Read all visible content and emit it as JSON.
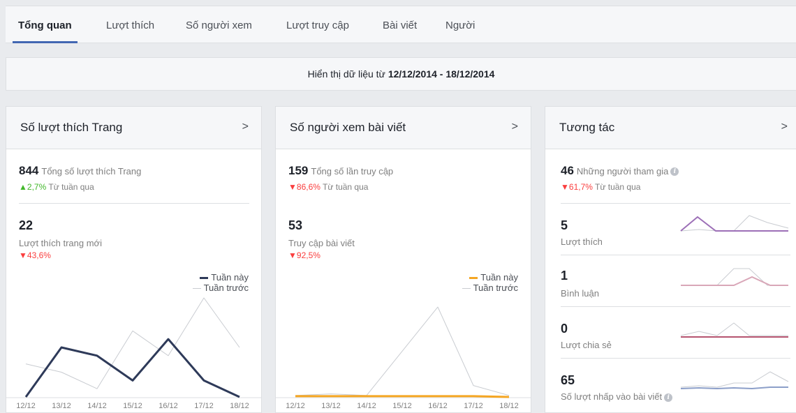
{
  "tabs": [
    {
      "label": "Tổng quan",
      "active": true
    },
    {
      "label": "Lượt thích"
    },
    {
      "label": "Số người xem"
    },
    {
      "label": "Lượt truy cập"
    },
    {
      "label": "Bài viết"
    },
    {
      "label": "Người"
    }
  ],
  "date_range": {
    "prefix": "Hiển thị dữ liệu từ",
    "range": "12/12/2014 - 18/12/2014"
  },
  "likes_card": {
    "title": "Số lượt thích Trang",
    "arrow": ">",
    "total_num": "844",
    "total_label": "Tổng số lượt thích Trang",
    "total_trend": "2,7%",
    "trend_suffix": "Từ tuần qua",
    "sub_num": "22",
    "sub_label": "Lượt thích trang mới",
    "sub_trend": "43,6%",
    "legend_this": "Tuần này",
    "legend_last": "Tuần trước"
  },
  "reach_card": {
    "title": "Số người xem bài viết",
    "arrow": ">",
    "total_num": "159",
    "total_label": "Tổng số lần truy cập",
    "total_trend": "86,6%",
    "trend_suffix": "Từ tuần qua",
    "sub_num": "53",
    "sub_label": "Truy cập bài viết",
    "sub_trend": "92,5%",
    "legend_this": "Tuần này",
    "legend_last": "Tuần trước"
  },
  "engagement_card": {
    "title": "Tương tác",
    "arrow": ">",
    "total_num": "46",
    "total_label": "Những người tham gia",
    "total_trend": "61,7%",
    "trend_suffix": "Từ tuần qua",
    "rows": [
      {
        "num": "5",
        "label": "Lượt thích"
      },
      {
        "num": "1",
        "label": "Bình luận"
      },
      {
        "num": "0",
        "label": "Lượt chia sẻ"
      },
      {
        "num": "65",
        "label": "Số lượt nhấp vào bài viết"
      }
    ]
  },
  "colors": {
    "likes_this_week": "#2e3a59",
    "reach_this_week": "#f5a623",
    "last_week": "#c9ccd1",
    "eng_likes": "#9c6fb7",
    "eng_comments": "#d9a7b8",
    "eng_shares": "#b5546f",
    "eng_clicks": "#8c9fc9"
  },
  "chart_data": [
    {
      "type": "line",
      "x": [
        "12/12",
        "13/12",
        "14/12",
        "15/12",
        "16/12",
        "17/12",
        "18/12"
      ],
      "ylim": [
        0,
        24
      ],
      "series": [
        {
          "name": "Tuần này",
          "values": [
            0,
            12,
            10,
            4,
            14,
            4,
            0
          ]
        },
        {
          "name": "Tuần trước",
          "values": [
            8,
            6,
            2,
            16,
            10,
            24,
            12
          ]
        }
      ]
    },
    {
      "type": "line",
      "x": [
        "12/12",
        "13/12",
        "14/12",
        "15/12",
        "16/12",
        "17/12",
        "18/12"
      ],
      "ylim": [
        0,
        130
      ],
      "series": [
        {
          "name": "Tuần này",
          "values": [
            1,
            1,
            1,
            1,
            1,
            1,
            0
          ]
        },
        {
          "name": "Tuần trước",
          "values": [
            2,
            4,
            2,
            60,
            118,
            15,
            2
          ]
        }
      ]
    }
  ]
}
